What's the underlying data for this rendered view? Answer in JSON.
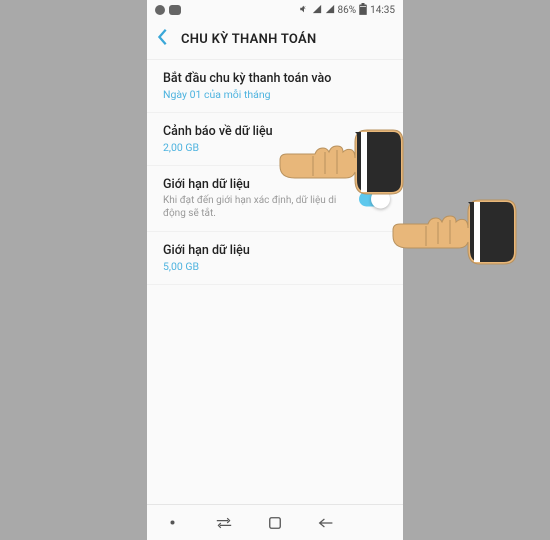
{
  "statusbar": {
    "battery_text": "86%",
    "time": "14:35"
  },
  "header": {
    "title": "CHU KỲ THANH TOÁN"
  },
  "items": {
    "start_cycle": {
      "title": "Bắt đầu chu kỳ thanh toán vào",
      "sub": "Ngày 01 của mỗi tháng"
    },
    "data_warning": {
      "title": "Cảnh báo về dữ liệu",
      "sub": "2,00 GB"
    },
    "data_limit_toggle": {
      "title": "Giới hạn dữ liệu",
      "desc": "Khi đạt đến giới hạn xác định, dữ liệu di động sẽ tắt."
    },
    "data_limit_value": {
      "title": "Giới hạn dữ liệu",
      "sub": "5,00 GB"
    }
  }
}
